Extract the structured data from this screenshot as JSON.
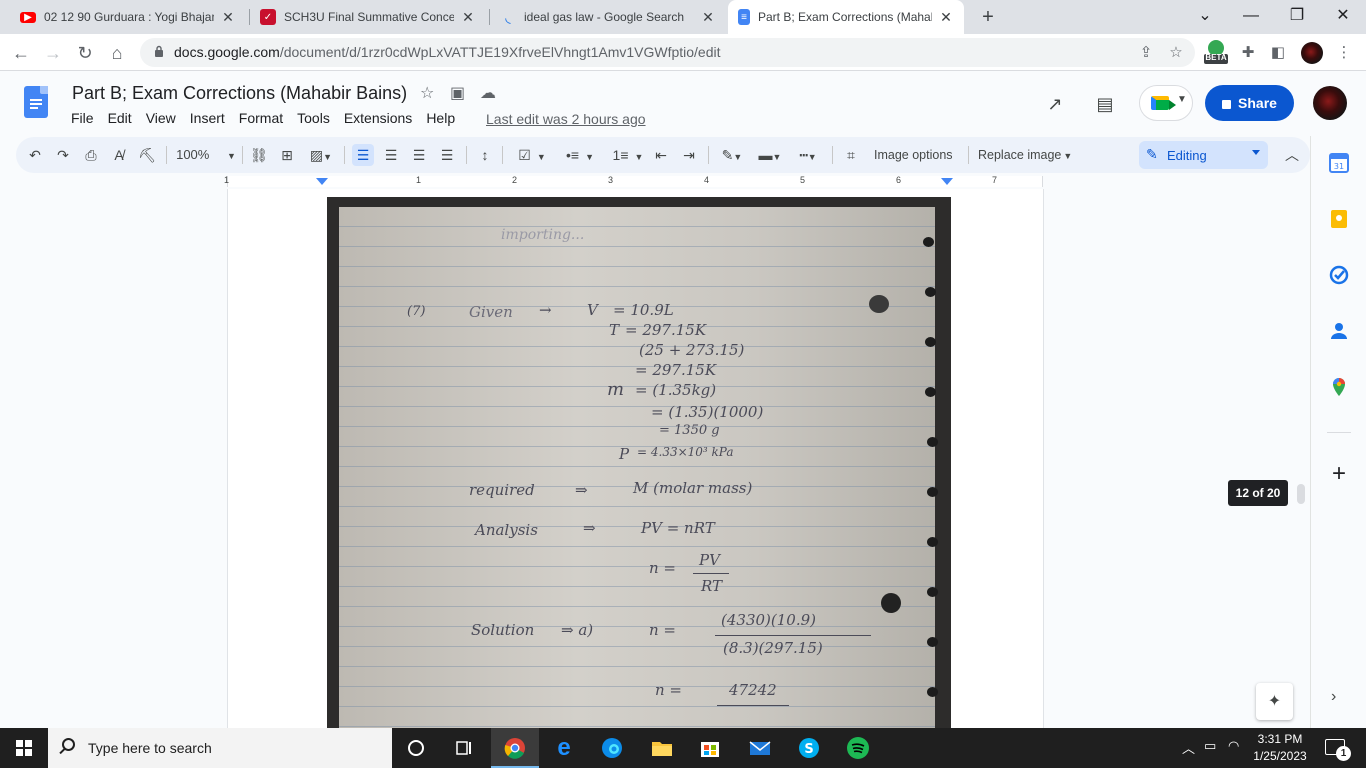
{
  "browser": {
    "tabs": [
      {
        "title": "02 12 90 Gurduara : Yogi Bhajan |",
        "icon": "youtube-icon",
        "active": false
      },
      {
        "title": "SCH3U Final Summative Concept",
        "icon": "edpuzzle-icon",
        "active": false
      },
      {
        "title": "ideal gas law - Google Search",
        "icon": "google-loading-icon",
        "active": false
      },
      {
        "title": "Part B; Exam Corrections (Mahab",
        "icon": "docs-icon",
        "active": true
      }
    ],
    "url_host": "docs.google.com",
    "url_path": "/document/d/1rzr0cdWpLxVATTJE19XfrveElVhngt1Amv1VGWfptio/edit",
    "beta_label": "BETA"
  },
  "doc": {
    "title": "Part B; Exam Corrections (Mahabir Bains)",
    "menu": [
      "File",
      "Edit",
      "View",
      "Insert",
      "Format",
      "Tools",
      "Extensions",
      "Help"
    ],
    "last_edit": "Last edit was 2 hours ago",
    "share_label": "Share"
  },
  "toolbar": {
    "zoom": "100%",
    "image_options": "Image options",
    "replace_image": "Replace image",
    "mode": "Editing"
  },
  "ruler": {
    "numbers": [
      "1",
      "1",
      "2",
      "3",
      "4",
      "5",
      "6",
      "7"
    ]
  },
  "handwriting": {
    "header": "importing...",
    "q_number": "(7)",
    "given": "Given",
    "arrow1": "→",
    "v_sym": "V",
    "v_val": "= 10.9L",
    "t_sym": "T",
    "t_val": "= 297.15K",
    "t_calc": "(25 + 273.15)",
    "t_res": "= 297.15K",
    "m_sym": "m",
    "m_val": "= (1.35kg)",
    "m_calc": "= (1.35)(1000)",
    "m_res": "= 1350 g",
    "p_sym": "P",
    "p_val": "= 4.33×10³ kPa",
    "required": "required",
    "req_arrow": "⇒",
    "req_val": "M (molar mass)",
    "analysis": "Analysis",
    "an_arrow": "⇒",
    "an_eq": "PV = nRT",
    "n_eq": "n =",
    "n_num": "PV",
    "n_den": "RT",
    "solution": "Solution",
    "sol_arrow": "⇒ a)",
    "sol_n": "n =",
    "sol_num": "(4330)(10.9)",
    "sol_den": "(8.3)(297.15)",
    "final_n": "n =",
    "final_num": "47242"
  },
  "page_counter": "12 of 20",
  "taskbar": {
    "search_placeholder": "Type here to search",
    "time": "3:31 PM",
    "date": "1/25/2023",
    "notif_count": "1"
  },
  "colors": {
    "accent": "#0b57d0",
    "docs_blue": "#4285f4",
    "toolbar_bg": "#edf2fa",
    "taskbar_bg": "#1f1f1f"
  }
}
